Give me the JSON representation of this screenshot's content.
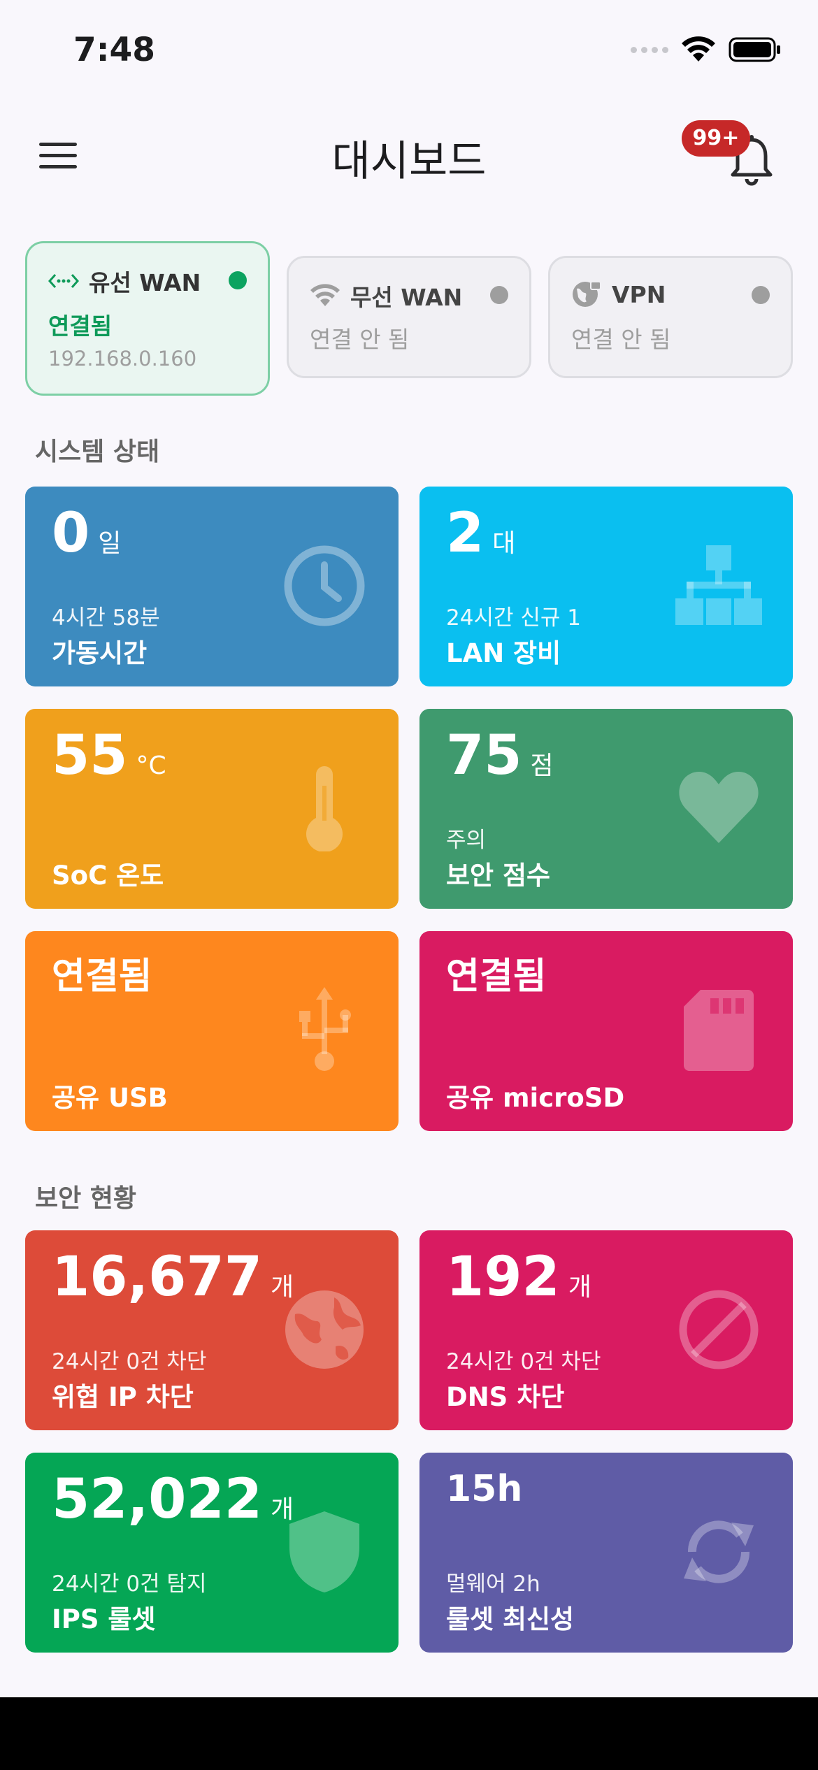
{
  "status_bar": {
    "time": "7:48"
  },
  "app_bar": {
    "title": "대시보드",
    "notification_badge": "99+"
  },
  "connections": [
    {
      "name": "유선 WAN",
      "status": "연결됨",
      "ip": "192.168.0.160",
      "icon": "ethernet-icon",
      "active": true
    },
    {
      "name": "무선 WAN",
      "status": "연결 안 됨",
      "icon": "wifi-icon",
      "active": false
    },
    {
      "name": "VPN",
      "status": "연결 안 됨",
      "icon": "vpn-globe-icon",
      "active": false
    }
  ],
  "sections": {
    "system": "시스템 상태",
    "security": "보안 현황"
  },
  "system_tiles": [
    {
      "value": "0",
      "unit": "일",
      "sub": "4시간 58분",
      "label": "가동시간",
      "icon": "clock-icon",
      "color": "#3d8bbf"
    },
    {
      "value": "2",
      "unit": "대",
      "sub": "24시간 신규 1",
      "label": "LAN 장비",
      "icon": "network-icon",
      "color": "#0abff0"
    },
    {
      "value": "55",
      "unit": "°C",
      "sub": "",
      "label": "SoC 온도",
      "icon": "thermometer-icon",
      "color": "#f0a01c"
    },
    {
      "value": "75",
      "unit": "점",
      "sub": "주의",
      "label": "보안 점수",
      "icon": "heart-icon",
      "color": "#3f9a6e"
    },
    {
      "value": "연결됨",
      "unit": "",
      "sub": "",
      "label": "공유 USB",
      "icon": "usb-icon",
      "color": "#fe871e"
    },
    {
      "value": "연결됨",
      "unit": "",
      "sub": "",
      "label": "공유 microSD",
      "icon": "sd-card-icon",
      "color": "#d91b61"
    }
  ],
  "security_tiles": [
    {
      "value": "16,677",
      "unit": "개",
      "sub": "24시간 0건 차단",
      "label": "위협 IP 차단",
      "icon": "globe-icon",
      "color": "#dd4b39"
    },
    {
      "value": "192",
      "unit": "개",
      "sub": "24시간 0건 차단",
      "label": "DNS 차단",
      "icon": "block-icon",
      "color": "#d91b61"
    },
    {
      "value": "52,022",
      "unit": "개",
      "sub": "24시간 0건 탐지",
      "label": "IPS 룰셋",
      "icon": "shield-icon",
      "color": "#05a655"
    },
    {
      "value": "15h",
      "unit": "",
      "sub": "멀웨어 2h",
      "label": "룰셋 최신성",
      "icon": "refresh-icon",
      "color": "#5f5ca6"
    }
  ]
}
